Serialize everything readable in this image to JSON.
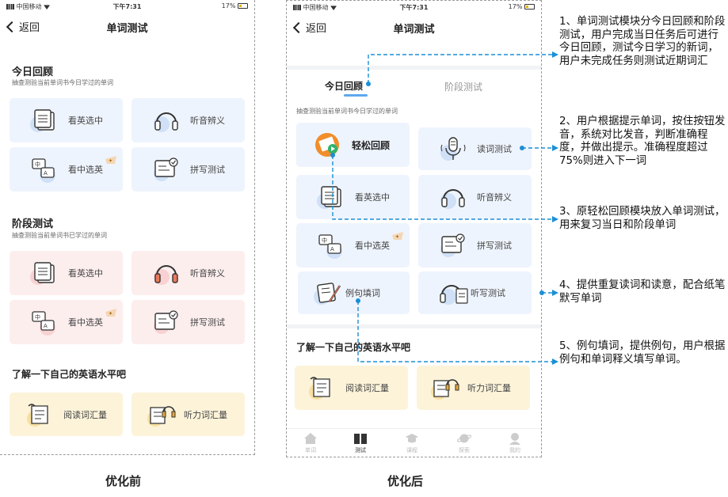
{
  "status_bar": {
    "carrier": "中国移动",
    "time": "下午7:31",
    "battery": "17%"
  },
  "nav": {
    "back_label": "返回",
    "title": "单词测试"
  },
  "before": {
    "today": {
      "title": "今日回顾",
      "subtitle": "抽查测验当前单词书今日学过的单词",
      "cards": [
        "看英选中",
        "听音辨义",
        "看中选英",
        "拼写测试"
      ]
    },
    "stage": {
      "title": "阶段测试",
      "subtitle": "抽查测验当前单词书已学过的单词",
      "cards": [
        "看英选中",
        "听音辨义",
        "看中选英",
        "拼写测试"
      ]
    },
    "level": {
      "title": "了解一下自己的英语水平吧",
      "cards": [
        "阅读词汇量",
        "听力词汇量"
      ]
    },
    "caption": "优化前"
  },
  "after": {
    "tabs": [
      "今日回顾",
      "阶段测试"
    ],
    "subtitle": "抽查测验当前单词书今日学过的单词",
    "cards": [
      "轻松回顾",
      "读词测试",
      "看英选中",
      "听音辨义",
      "看中选英",
      "拼写测试",
      "例句填词",
      "听写测试"
    ],
    "level": {
      "title": "了解一下自己的英语水平吧",
      "cards": [
        "阅读词汇量",
        "听力词汇量"
      ]
    },
    "tabbar": [
      "单词",
      "测试",
      "课程",
      "探索",
      "我的"
    ],
    "caption": "优化后"
  },
  "annotations": [
    "1、单词测试模块分今日回顾和阶段测试，用户完成当日任务后可进行今日回顾，测试今日学习的新词，用户未完成任务则测试近期词汇",
    "2、用户根据提示单词，按住按钮发音，系统对比发音，判断准确程度，并做出提示。准确程度超过75%则进入下一词",
    "3、原轻松回顾模块放入单词测试，用来复习当日和阶段单词",
    "4、提供重复读词和读意，配合纸笔默写单词",
    "5、例句填词，提供例句，用户根据例句和单词释义填写单词。"
  ],
  "colors": {
    "accent": "#1a8fd6",
    "card_blue": "#eef4fd",
    "card_pink": "#fdeeee",
    "card_yellow": "#fcf3d9",
    "tab_underline": "#5ea8ee"
  }
}
